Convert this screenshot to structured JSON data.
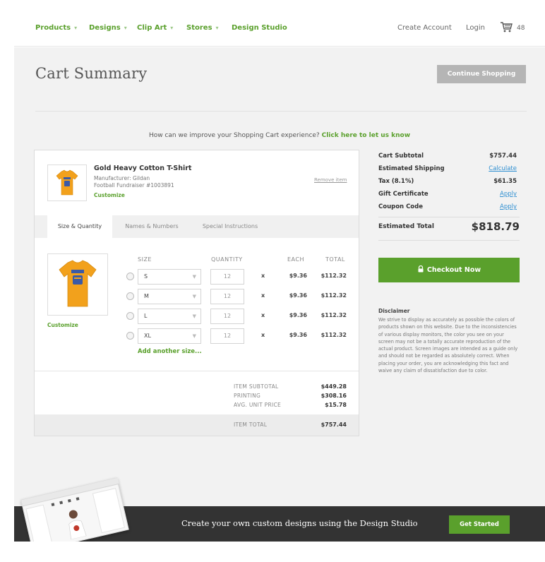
{
  "nav": {
    "items": [
      {
        "label": "Products",
        "caret": "▾"
      },
      {
        "label": "Designs",
        "caret": "▾"
      },
      {
        "label": "Clip Art",
        "caret": "▾"
      },
      {
        "label": "Stores",
        "caret": "▾"
      },
      {
        "label": "Design Studio",
        "caret": ""
      }
    ],
    "create_account": "Create Account",
    "login": "Login",
    "cart_count": "48"
  },
  "header": {
    "title": "Cart Summary",
    "continue_label": "Continue Shopping"
  },
  "feedback": {
    "text": "How can we improve your Shopping Cart experience?",
    "link": "Click here to let us know"
  },
  "product": {
    "name": "Gold Heavy Cotton T-Shirt",
    "manufacturer": "Manufacturer: Gildan",
    "store": "Football Fundraiser #1003891",
    "customize": "Customize",
    "remove": "Remove item"
  },
  "tabs": [
    "Size & Quantity",
    "Names & Numbers",
    "Special Instructions"
  ],
  "columns": {
    "size": "SIZE",
    "quantity": "QUANTITY",
    "each": "EACH",
    "total": "TOTAL"
  },
  "rows": [
    {
      "size": "S",
      "quantity": "12",
      "times": "x",
      "each": "$9.36",
      "total": "$112.32"
    },
    {
      "size": "M",
      "quantity": "12",
      "times": "x",
      "each": "$9.36",
      "total": "$112.32"
    },
    {
      "size": "L",
      "quantity": "12",
      "times": "x",
      "each": "$9.36",
      "total": "$112.32"
    },
    {
      "size": "XL",
      "quantity": "12",
      "times": "x",
      "each": "$9.36",
      "total": "$112.32"
    }
  ],
  "add_size": "Add another size...",
  "item_summary": {
    "subtotal_label": "ITEM SUBTOTAL",
    "subtotal": "$449.28",
    "printing_label": "PRINTING",
    "printing": "$308.16",
    "avg_label": "AVG. UNIT PRICE",
    "avg": "$15.78",
    "total_label": "ITEM TOTAL",
    "total": "$757.44"
  },
  "summary": {
    "rows": [
      {
        "label": "Cart Subtotal",
        "value": "$757.44"
      },
      {
        "label": "Estimated Shipping",
        "value": "Calculate"
      },
      {
        "label": "Tax (8.1%)",
        "value": "$61.35"
      },
      {
        "label": "Gift Certificate",
        "value": "Apply"
      },
      {
        "label": "Coupon Code",
        "value": "Apply"
      }
    ],
    "estimated_total_label": "Estimated Total",
    "estimated_total": "$818.79",
    "checkout_label": "Checkout Now",
    "disclaimer_title": "Disclaimer",
    "disclaimer_text": "We strive to display as accurately as possible the colors of products shown on this website. Due to the inconsistencies of various display monitors, the color you see on your screen may not be a totally accurate reproduction of the actual product. Screen images are intended as a guide only and should not be regarded as absolutely correct. When placing your order, you are acknowledging this fact and waive any claim of dissatisfaction due to color."
  },
  "banner": {
    "text": "Create your own custom designs using the Design Studio",
    "button": "Get Started"
  },
  "colors": {
    "accent_green": "#5aa02c",
    "link_blue": "#2f8fd1",
    "banner_dark": "#333333",
    "shirt_gold": "#f2a11c"
  }
}
